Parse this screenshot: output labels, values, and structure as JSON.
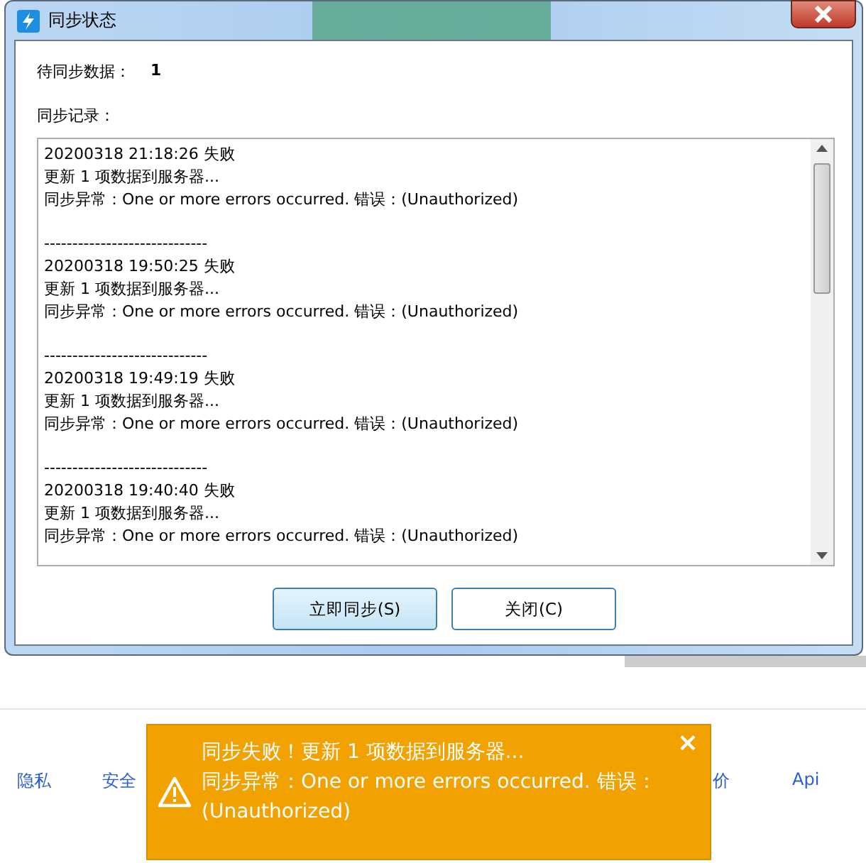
{
  "window": {
    "title": "同步状态"
  },
  "pending": {
    "label": "待同步数据：",
    "value": "1"
  },
  "log_label": "同步记录：",
  "log": [
    {
      "time": "20200318 21:18:26 失败",
      "line_1": "更新 1 项数据到服务器...",
      "line_2": "同步异常：One or more errors occurred. 错误：(Unauthorized)",
      "separator": "-----------------------------"
    },
    {
      "time": "20200318 19:50:25 失败",
      "line_1": "更新 1 项数据到服务器...",
      "line_2": "同步异常：One or more errors occurred. 错误：(Unauthorized)",
      "separator": "-----------------------------"
    },
    {
      "time": "20200318 19:49:19 失败",
      "line_1": "更新 1 项数据到服务器...",
      "line_2": "同步异常：One or more errors occurred. 错误：(Unauthorized)",
      "separator": "-----------------------------"
    },
    {
      "time": "20200318 19:40:40 失败",
      "line_1": "更新 1 项数据到服务器...",
      "line_2": "同步异常：One or more errors occurred. 错误：(Unauthorized)"
    }
  ],
  "buttons": [
    {
      "label": "立即同步(S)",
      "selected": true
    },
    {
      "label": "关闭(C)",
      "selected": false
    }
  ],
  "footer_links": [
    "隐私",
    "安全",
    "价",
    "Api"
  ],
  "toast": {
    "title": "同步失败！更新 1 项数据到服务器...",
    "message": "同步异常：One or more errors occurred. 错误：(Unauthorized)",
    "close": "×"
  }
}
